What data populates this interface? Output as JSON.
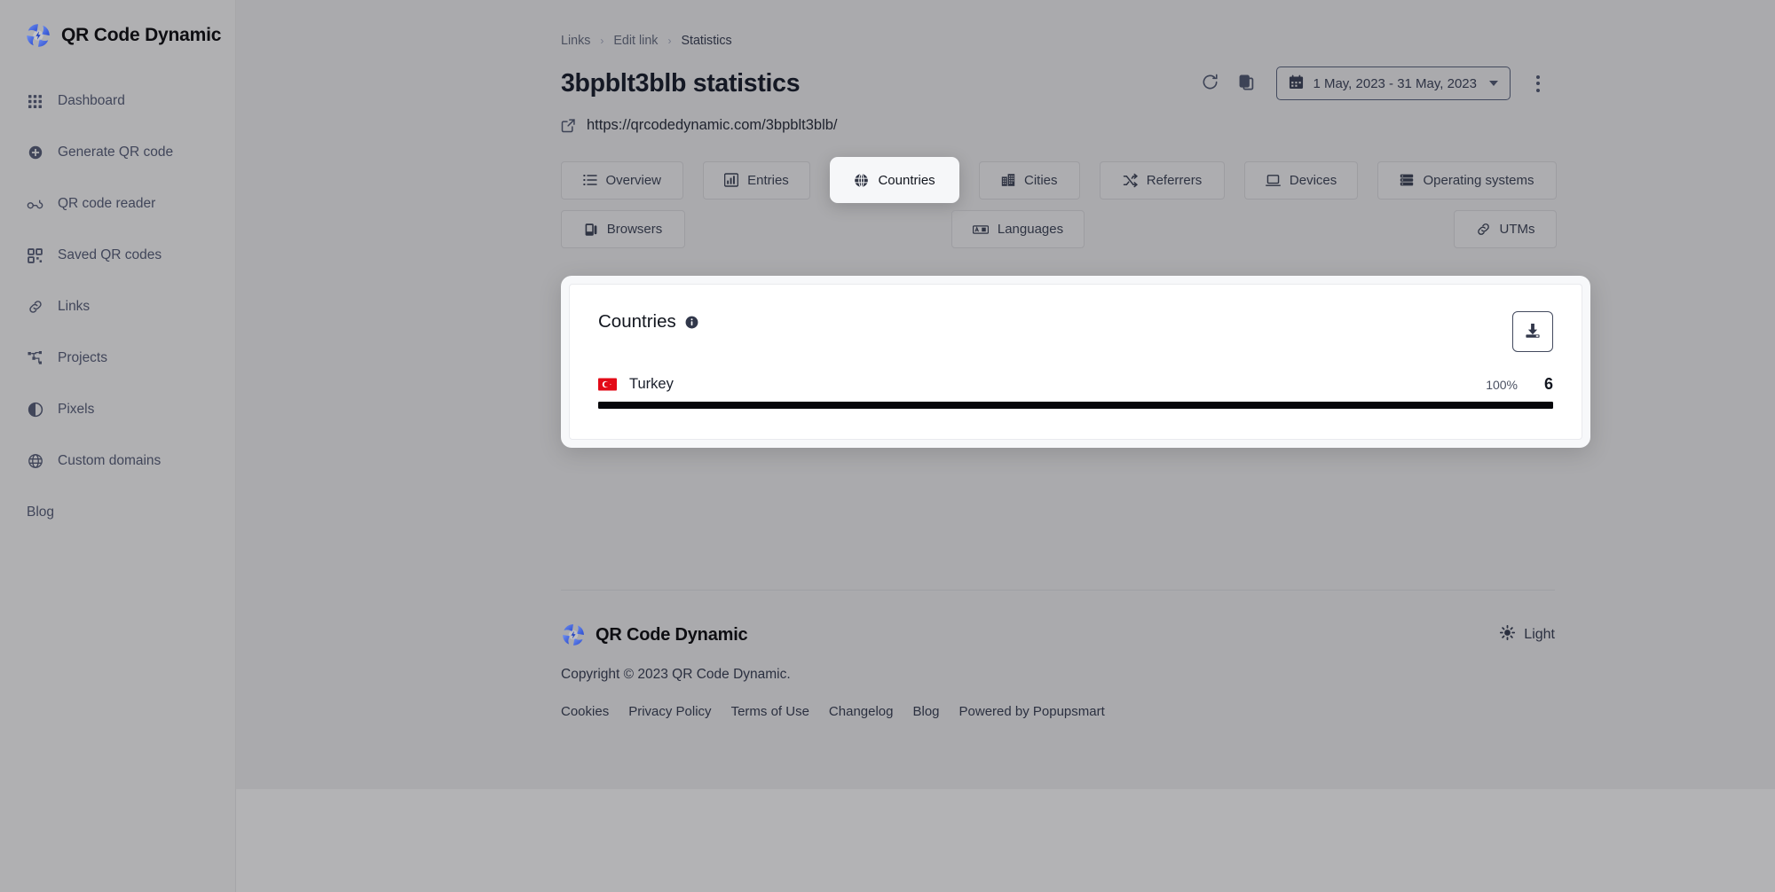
{
  "brand": {
    "name": "QR Code Dynamic"
  },
  "sidebar": {
    "items": [
      {
        "label": "Dashboard",
        "icon": "grid-icon"
      },
      {
        "label": "Generate QR code",
        "icon": "plus-circle-icon"
      },
      {
        "label": "QR code reader",
        "icon": "scan-icon"
      },
      {
        "label": "Saved QR codes",
        "icon": "qr-icon"
      },
      {
        "label": "Links",
        "icon": "link-icon"
      },
      {
        "label": "Projects",
        "icon": "sitemap-icon"
      },
      {
        "label": "Pixels",
        "icon": "contrast-circle-icon"
      },
      {
        "label": "Custom domains",
        "icon": "globe-icon"
      }
    ],
    "blog": {
      "label": "Blog"
    }
  },
  "breadcrumb": {
    "items": [
      "Links",
      "Edit link",
      "Statistics"
    ],
    "separator": "›"
  },
  "header": {
    "title": "3bpblt3blb statistics",
    "refresh_icon": "refresh-icon",
    "copy_icon": "copy-icon",
    "date_range": "1 May, 2023 - 31 May, 2023",
    "calendar_icon": "calendar-icon",
    "more_icon": "kebab-menu-icon",
    "url": "https://qrcodedynamic.com/3bpblt3blb/",
    "external_icon": "external-link-icon"
  },
  "tabs": {
    "row1": [
      {
        "label": "Overview",
        "icon": "list-icon",
        "active": false
      },
      {
        "label": "Entries",
        "icon": "bar-chart-icon",
        "active": false
      },
      {
        "label": "Countries",
        "icon": "globe-icon",
        "active": true
      },
      {
        "label": "Cities",
        "icon": "city-icon",
        "active": false
      },
      {
        "label": "Referrers",
        "icon": "shuffle-icon",
        "active": false
      },
      {
        "label": "Devices",
        "icon": "laptop-icon",
        "active": false
      },
      {
        "label": "Operating systems",
        "icon": "server-icon",
        "active": false
      }
    ],
    "row2": [
      {
        "label": "Browsers",
        "icon": "browser-icon",
        "active": false
      },
      {
        "label": "Languages",
        "icon": "translate-icon",
        "active": false
      },
      {
        "label": "UTMs",
        "icon": "link-icon",
        "active": false
      }
    ]
  },
  "card": {
    "title": "Countries",
    "info_icon": "info-icon",
    "download_icon": "download-icon"
  },
  "chart_data": {
    "type": "bar",
    "title": "Countries",
    "categories": [
      "Turkey"
    ],
    "values": [
      6
    ],
    "percentages": [
      "100%"
    ],
    "flags": [
      "tr"
    ],
    "total": 6,
    "xlabel": "",
    "ylabel": "",
    "bar_color": "#06060a",
    "track_color": "#eceef1"
  },
  "footer": {
    "brand": "QR Code Dynamic",
    "copyright": "Copyright © 2023 QR Code Dynamic.",
    "links": [
      "Cookies",
      "Privacy Policy",
      "Terms of Use",
      "Changelog",
      "Blog",
      "Powered by Popupsmart"
    ],
    "theme": {
      "label": "Light",
      "icon": "sun-icon"
    }
  },
  "colors": {
    "page_background": "#aaaaad",
    "sidebar_background": "#b0b0b2",
    "card_background": "#ffffff",
    "accent": "#3b5bdb",
    "text_primary": "#12161f",
    "flag_red": "#e30a17"
  }
}
